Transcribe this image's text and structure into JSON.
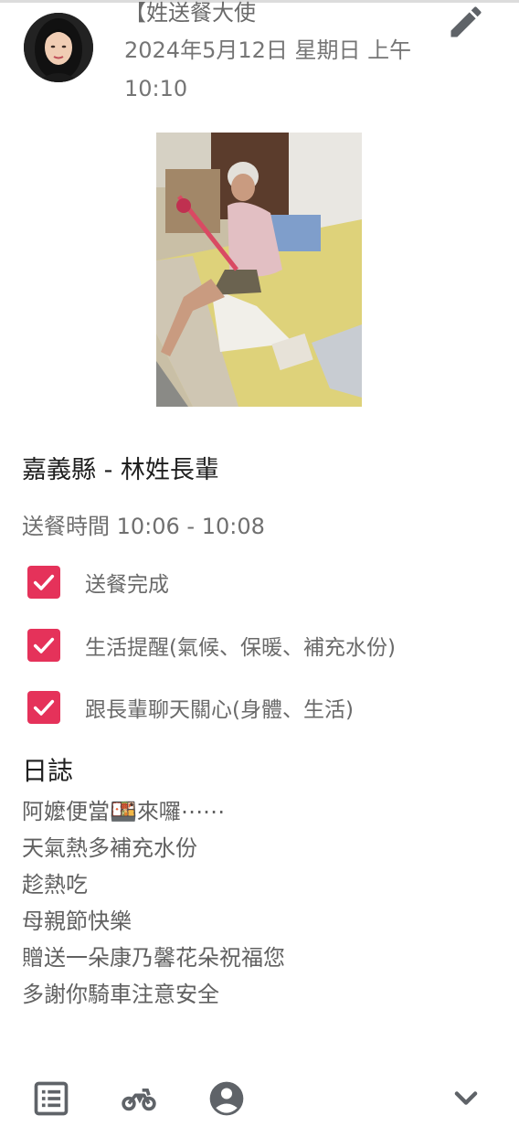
{
  "post": {
    "author": "【姓送餐大使",
    "datetime": "2024年5月12日 星期日 上午10:10"
  },
  "entry": {
    "title": "嘉義縣 - 林姓長輩",
    "time": "送餐時間 10:06 - 10:08"
  },
  "checklist": [
    {
      "label": "送餐完成",
      "checked": true
    },
    {
      "label": "生活提醒(氣候、保暖、補充水份)",
      "checked": true
    },
    {
      "label": "跟長輩聊天關心(身體、生活)",
      "checked": true
    }
  ],
  "log": {
    "heading": "日誌",
    "lines": [
      "阿嬤便當🍱來囉⋯⋯",
      "天氣熱多補充水份",
      "趁熱吃",
      "母親節快樂",
      "贈送一朵康乃馨花朵祝福您",
      "多謝你騎車注意安全"
    ]
  },
  "icons": {
    "edit": "pencil-icon",
    "list": "list-icon",
    "ride": "motorcycle-icon",
    "account": "account-icon",
    "expand": "chevron-down-icon"
  },
  "colors": {
    "accent": "#e5325a",
    "icon": "#5f6368"
  }
}
